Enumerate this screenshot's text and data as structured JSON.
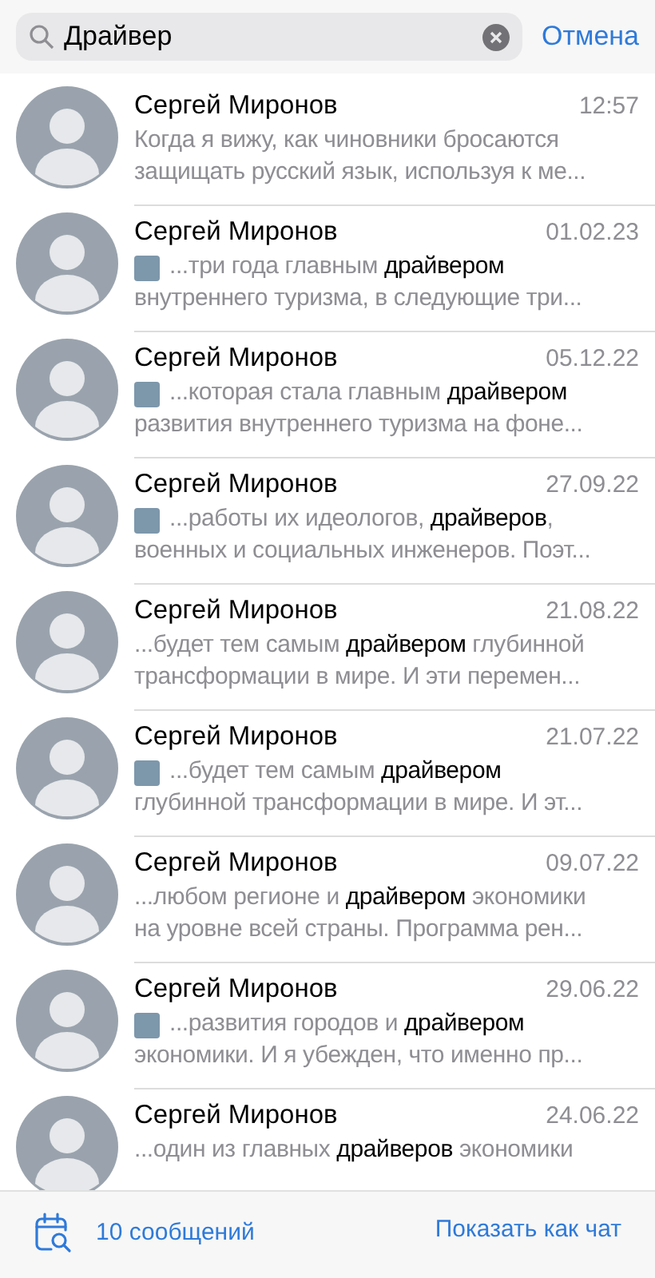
{
  "search": {
    "value": "Драйвер",
    "cancel": "Отмена"
  },
  "results": [
    {
      "name": "Сергей Миронов",
      "time": "12:57",
      "thumbnail": false,
      "lines": [
        "Когда я вижу, как чиновники бросаются",
        "защищать русский язык, используя к ме..."
      ]
    },
    {
      "name": "Сергей Миронов",
      "time": "01.02.23",
      "thumbnail": true,
      "lines": [
        "...три года главным **драйвером**",
        "внутреннего туризма, в следующие три..."
      ]
    },
    {
      "name": "Сергей Миронов",
      "time": "05.12.22",
      "thumbnail": true,
      "lines": [
        "...которая стала главным **драйвером**",
        "развития внутреннего туризма на фоне..."
      ]
    },
    {
      "name": "Сергей Миронов",
      "time": "27.09.22",
      "thumbnail": true,
      "lines": [
        "...работы их идеологов, **драйверов**,",
        "военных и социальных инженеров. Поэт..."
      ]
    },
    {
      "name": "Сергей Миронов",
      "time": "21.08.22",
      "thumbnail": false,
      "lines": [
        "...будет тем самым **драйвером** глубинной",
        "трансформации в мире. И эти перемен..."
      ]
    },
    {
      "name": "Сергей Миронов",
      "time": "21.07.22",
      "thumbnail": true,
      "lines": [
        "...будет тем самым **драйвером**",
        "глубинной трансформации в мире. И эт..."
      ]
    },
    {
      "name": "Сергей Миронов",
      "time": "09.07.22",
      "thumbnail": false,
      "lines": [
        "...любом регионе и **драйвером** экономики",
        "на уровне всей страны. Программа рен..."
      ]
    },
    {
      "name": "Сергей Миронов",
      "time": "29.06.22",
      "thumbnail": true,
      "lines": [
        "...развития городов и **драйвером**",
        "экономики. И я убежден, что именно пр..."
      ]
    },
    {
      "name": "Сергей Миронов",
      "time": "24.06.22",
      "thumbnail": false,
      "lines": [
        "...один из главных **драйверов** экономики"
      ]
    }
  ],
  "footer": {
    "count": "10 сообщений",
    "show_as_chat": "Показать как чат"
  }
}
